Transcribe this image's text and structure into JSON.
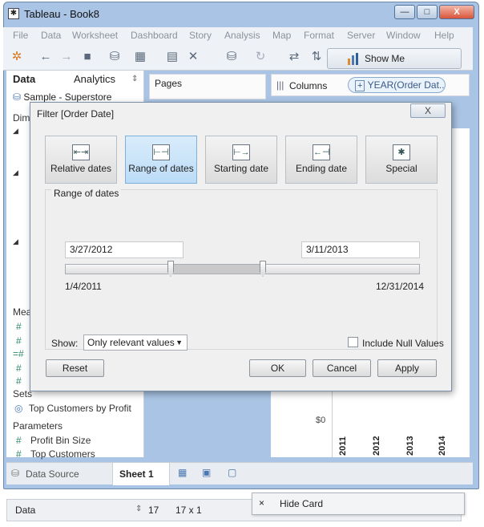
{
  "window": {
    "title": "Tableau - Book8",
    "minimize": "—",
    "maximize": "□",
    "close": "X"
  },
  "menu": [
    "File",
    "Data",
    "Worksheet",
    "Dashboard",
    "Story",
    "Analysis",
    "Map",
    "Format",
    "Server",
    "Window",
    "Help"
  ],
  "toolbar": {
    "show_me": "Show Me"
  },
  "left_pane": {
    "tabs": [
      "Data",
      "Analytics"
    ],
    "datasource": "Sample - Superstore",
    "dim_label": "Dim",
    "measures_label": "Mea",
    "sets_label": "Sets",
    "sets_item": "Top Customers by Profit",
    "parameters_label": "Parameters",
    "params": [
      "Profit Bin Size",
      "Top Customers"
    ]
  },
  "pages_label": "Pages",
  "columns": {
    "label": "Columns",
    "pill": "YEAR(Order Dat.."
  },
  "chart": {
    "y_tick": "$0",
    "x_ticks": [
      "2011",
      "2012",
      "2013",
      "2014"
    ]
  },
  "bottom": {
    "data_source": "Data Source",
    "sheet": "Sheet 1"
  },
  "status": {
    "data": "Data",
    "marks": "17",
    "size": "17 x 1",
    "hide_card": "Hide Card",
    "hide_x": "×"
  },
  "dialog": {
    "title": "Filter [Order Date]",
    "close": "X",
    "modes": [
      {
        "label": "Relative dates"
      },
      {
        "label": "Range of dates",
        "selected": true
      },
      {
        "label": "Starting date"
      },
      {
        "label": "Ending date"
      },
      {
        "label": "Special"
      }
    ],
    "range_label": "Range of dates",
    "start_value": "3/27/2012",
    "end_value": "3/11/2013",
    "min_date": "1/4/2011",
    "max_date": "12/31/2014",
    "show_label": "Show:",
    "show_value": "Only relevant values",
    "include_null": "Include Null Values",
    "buttons": {
      "reset": "Reset",
      "ok": "OK",
      "cancel": "Cancel",
      "apply": "Apply"
    }
  }
}
